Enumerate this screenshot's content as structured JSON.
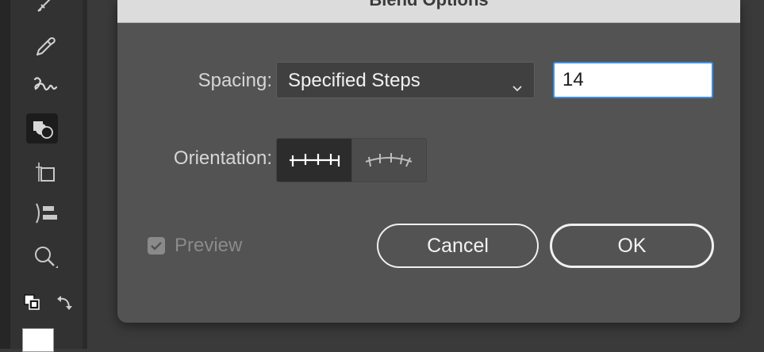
{
  "dialog": {
    "title": "Blend Options",
    "spacing_label": "Spacing:",
    "spacing_value": "Specified Steps",
    "steps_value": "14",
    "orientation_label": "Orientation:",
    "preview_label": "Preview",
    "preview_checked": true,
    "cancel_label": "Cancel",
    "ok_label": "OK"
  },
  "toolbar": {
    "tools": [
      {
        "icon": "pencil-icon"
      },
      {
        "icon": "eyedropper-icon"
      },
      {
        "icon": "blend-tool-icon",
        "active": true
      },
      {
        "icon": "shape-builder-icon"
      },
      {
        "icon": "artboard-icon"
      },
      {
        "icon": "align-icon"
      },
      {
        "icon": "zoom-icon"
      },
      {
        "icon": "fill-stroke-icon"
      },
      {
        "icon": "swap-fill-stroke-icon"
      }
    ]
  },
  "colors": {
    "dialog_bg": "#535353",
    "focus_ring": "#3b8ee8",
    "toolbar_bg": "#323232"
  }
}
